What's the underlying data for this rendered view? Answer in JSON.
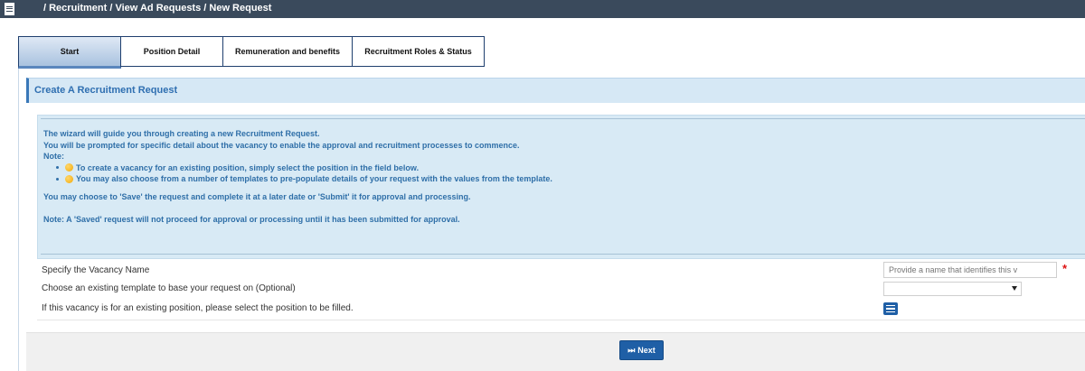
{
  "topbar": {
    "menu_icon": "hamburger-icon",
    "breadcrumb": "/ Recruitment / View Ad Requests / New Request"
  },
  "tabs": [
    {
      "label": "Start",
      "active": true
    },
    {
      "label": "Position Detail",
      "active": false
    },
    {
      "label": "Remuneration and benefits",
      "active": false
    },
    {
      "label": "Recruitment Roles & Status",
      "active": false
    }
  ],
  "panel": {
    "title": "Create A Recruitment Request"
  },
  "info": {
    "line1": "The wizard will guide you through creating a new Recruitment Request.",
    "line2": "You will be prompted for specific detail about the vacancy to enable the approval and recruitment processes to commence.",
    "note_label": "Note:",
    "bullets": [
      "To create a vacancy for an existing position, simply select the position in the field below.",
      "You may also choose from a number of templates to pre-populate details of your request with the values from the template."
    ],
    "save_text": "You may choose to 'Save' the request and complete it at a later date or 'Submit' it for approval and processing.",
    "saved_note": "Note: A 'Saved' request will not proceed for approval or processing until it has been submitted for approval."
  },
  "form": {
    "vacancy_label": "Specify the Vacancy Name",
    "vacancy_placeholder": "Provide a name that identifies this v",
    "vacancy_value": "",
    "required_mark": "*",
    "template_label": "Choose an existing template to base your request on (Optional)",
    "template_selected": "",
    "position_label": "If this vacancy is for an existing position, please select the position to be filled.",
    "position_icon": "list-icon"
  },
  "footer": {
    "next_label": "Next",
    "next_icon": "skip-next-icon"
  },
  "colors": {
    "topbar": "#3a4a5c",
    "accent": "#1f5fa6",
    "info_bg": "#d8eaf5",
    "info_text": "#2f6fa8",
    "required": "#dd1111"
  }
}
